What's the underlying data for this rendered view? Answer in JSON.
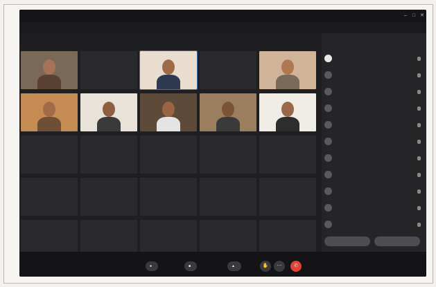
{
  "window": {
    "title": "",
    "controls": [
      "–",
      "□",
      "✕"
    ]
  },
  "menubar": {
    "text": ""
  },
  "subbar": {
    "text": ""
  },
  "video_tiles": [
    {
      "name": "",
      "has_video": true,
      "skin": "#a57357",
      "bg": "#7a6858",
      "shirt": "#5a4030"
    },
    {
      "name": "",
      "has_video": false
    },
    {
      "name": "",
      "has_video": true,
      "skin": "#9d6a4a",
      "bg": "#e9ddd0",
      "shirt": "#2e3a52",
      "active": true
    },
    {
      "name": "",
      "has_video": false
    },
    {
      "name": "",
      "has_video": true,
      "skin": "#b07850",
      "bg": "#cfb49a",
      "shirt": "#7a6a5a"
    },
    {
      "name": "",
      "has_video": true,
      "skin": "#a16b48",
      "bg": "#c48b52",
      "shirt": "#6e4e36"
    },
    {
      "name": "",
      "has_video": true,
      "skin": "#8e5e40",
      "bg": "#e8e2d8",
      "shirt": "#3a3a3a"
    },
    {
      "name": "",
      "has_video": true,
      "skin": "#9a6547",
      "bg": "#5e4a38",
      "shirt": "#e4e4e4"
    },
    {
      "name": "",
      "has_video": true,
      "skin": "#7e5236",
      "bg": "#9b7e5e",
      "shirt": "#3a3a3a"
    },
    {
      "name": "",
      "has_video": true,
      "skin": "#9a6748",
      "bg": "#f0ece6",
      "shirt": "#2d2d2d"
    }
  ],
  "name_tiles_count": 15,
  "name_tiles": [
    "",
    "",
    "",
    "",
    "",
    "",
    "",
    "",
    "",
    "",
    "",
    "",
    "",
    "",
    ""
  ],
  "participants_panel": {
    "title": "",
    "items": [
      "",
      "",
      "",
      "",
      "",
      "",
      "",
      "",
      "",
      "",
      ""
    ]
  },
  "panel_buttons": {
    "left": "",
    "right": ""
  },
  "controls": {
    "status": "",
    "unmute": "",
    "video": "",
    "share": ""
  },
  "colors": {
    "accent": "#3f6fb5",
    "leave": "#e04336"
  }
}
